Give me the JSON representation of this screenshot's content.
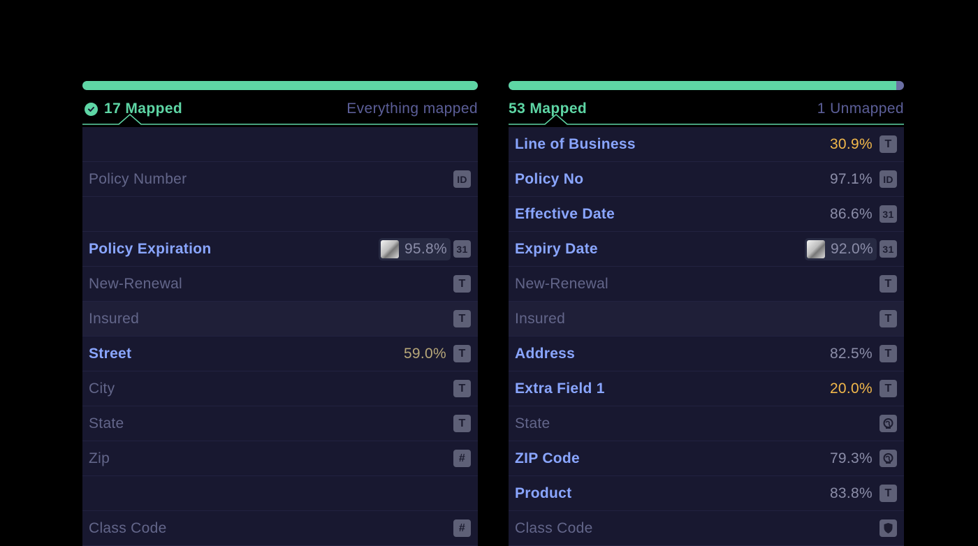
{
  "left_panel": {
    "progress_percent": 100,
    "mapped_count_label": "17 Mapped",
    "status_label": "Everything mapped",
    "rows": [
      {
        "label": "",
        "type": "",
        "percent": "",
        "state": "empty"
      },
      {
        "label": "Policy Number",
        "type": "ID",
        "percent": "",
        "state": "unmapped"
      },
      {
        "label": "",
        "type": "",
        "percent": "",
        "state": "empty"
      },
      {
        "label": "Policy Expiration",
        "type": "31",
        "percent": "95.8%",
        "state": "mapped",
        "confidence_chip": true
      },
      {
        "label": "New-Renewal",
        "type": "T",
        "percent": "",
        "state": "unmapped"
      },
      {
        "label": "Insured",
        "type": "T",
        "percent": "",
        "state": "unmapped",
        "highlight": true
      },
      {
        "label": "Street",
        "type": "T",
        "percent": "59.0%",
        "state": "mapped",
        "percent_tone": "mid"
      },
      {
        "label": "City",
        "type": "T",
        "percent": "",
        "state": "unmapped"
      },
      {
        "label": "State",
        "type": "T",
        "percent": "",
        "state": "unmapped"
      },
      {
        "label": "Zip",
        "type": "#",
        "percent": "",
        "state": "unmapped"
      },
      {
        "label": "",
        "type": "",
        "percent": "",
        "state": "empty"
      },
      {
        "label": "Class Code",
        "type": "#",
        "percent": "",
        "state": "unmapped"
      }
    ]
  },
  "right_panel": {
    "progress_percent": 98,
    "mapped_count_label": "53 Mapped",
    "status_label": "1 Unmapped",
    "rows": [
      {
        "label": "Line of Business",
        "type": "T",
        "percent": "30.9%",
        "state": "mapped",
        "percent_tone": "warn"
      },
      {
        "label": "Policy No",
        "type": "ID",
        "percent": "97.1%",
        "state": "mapped"
      },
      {
        "label": "Effective Date",
        "type": "31",
        "percent": "86.6%",
        "state": "mapped"
      },
      {
        "label": "Expiry Date",
        "type": "31",
        "percent": "92.0%",
        "state": "mapped",
        "confidence_chip": true
      },
      {
        "label": "New-Renewal",
        "type": "T",
        "percent": "",
        "state": "unmapped"
      },
      {
        "label": "Insured",
        "type": "T",
        "percent": "",
        "state": "unmapped",
        "highlight": true
      },
      {
        "label": "Address",
        "type": "T",
        "percent": "82.5%",
        "state": "mapped"
      },
      {
        "label": "Extra Field 1",
        "type": "T",
        "percent": "20.0%",
        "state": "mapped",
        "percent_tone": "warn"
      },
      {
        "label": "State",
        "type": "globe",
        "percent": "",
        "state": "unmapped"
      },
      {
        "label": "ZIP Code",
        "type": "globe",
        "percent": "79.3%",
        "state": "mapped"
      },
      {
        "label": "Product",
        "type": "T",
        "percent": "83.8%",
        "state": "mapped"
      },
      {
        "label": "Class Code",
        "type": "shield",
        "percent": "",
        "state": "unmapped"
      }
    ]
  },
  "colors": {
    "accent_green": "#5ed6a5",
    "mapped_blue": "#8aa6ff",
    "warning_orange": "#f2b84b",
    "panel_bg": "#181830"
  }
}
